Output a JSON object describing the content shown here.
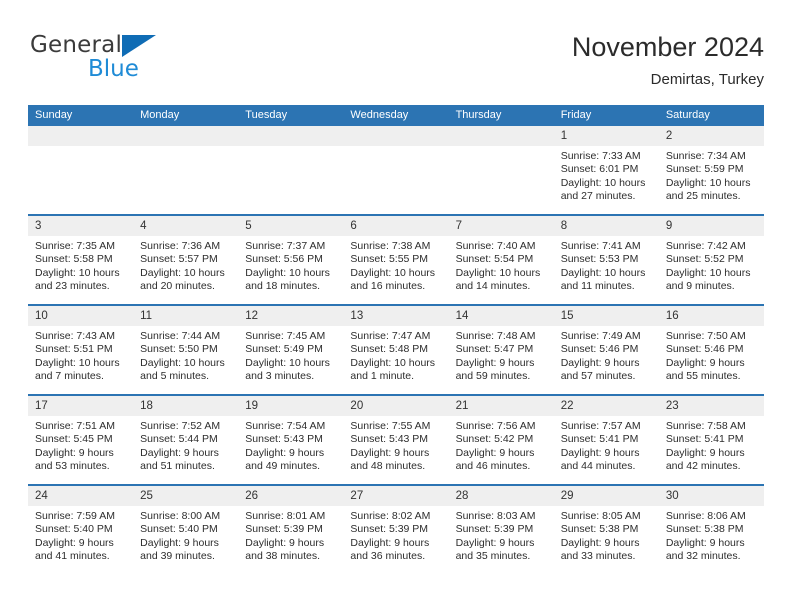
{
  "brand": {
    "name_part1": "General",
    "name_part2": "Blue",
    "logo_icon": "triangle-logo-icon",
    "accent_color": "#0f6cb5",
    "blue_text_color": "#1f8bd6"
  },
  "header": {
    "title": "November 2024",
    "subtitle": "Demirtas, Turkey"
  },
  "theme": {
    "header_blue": "#2c74b3",
    "daynum_band": "#efefef",
    "text": "#2d2d2d"
  },
  "weekdays": [
    "Sunday",
    "Monday",
    "Tuesday",
    "Wednesday",
    "Thursday",
    "Friday",
    "Saturday"
  ],
  "labels": {
    "sunrise": "Sunrise:",
    "sunset": "Sunset:",
    "daylight": "Daylight:"
  },
  "weeks": [
    [
      {
        "day": "",
        "sunrise": "",
        "sunset": "",
        "daylight": ""
      },
      {
        "day": "",
        "sunrise": "",
        "sunset": "",
        "daylight": ""
      },
      {
        "day": "",
        "sunrise": "",
        "sunset": "",
        "daylight": ""
      },
      {
        "day": "",
        "sunrise": "",
        "sunset": "",
        "daylight": ""
      },
      {
        "day": "",
        "sunrise": "",
        "sunset": "",
        "daylight": ""
      },
      {
        "day": "1",
        "sunrise": "Sunrise: 7:33 AM",
        "sunset": "Sunset: 6:01 PM",
        "daylight": "Daylight: 10 hours and 27 minutes."
      },
      {
        "day": "2",
        "sunrise": "Sunrise: 7:34 AM",
        "sunset": "Sunset: 5:59 PM",
        "daylight": "Daylight: 10 hours and 25 minutes."
      }
    ],
    [
      {
        "day": "3",
        "sunrise": "Sunrise: 7:35 AM",
        "sunset": "Sunset: 5:58 PM",
        "daylight": "Daylight: 10 hours and 23 minutes."
      },
      {
        "day": "4",
        "sunrise": "Sunrise: 7:36 AM",
        "sunset": "Sunset: 5:57 PM",
        "daylight": "Daylight: 10 hours and 20 minutes."
      },
      {
        "day": "5",
        "sunrise": "Sunrise: 7:37 AM",
        "sunset": "Sunset: 5:56 PM",
        "daylight": "Daylight: 10 hours and 18 minutes."
      },
      {
        "day": "6",
        "sunrise": "Sunrise: 7:38 AM",
        "sunset": "Sunset: 5:55 PM",
        "daylight": "Daylight: 10 hours and 16 minutes."
      },
      {
        "day": "7",
        "sunrise": "Sunrise: 7:40 AM",
        "sunset": "Sunset: 5:54 PM",
        "daylight": "Daylight: 10 hours and 14 minutes."
      },
      {
        "day": "8",
        "sunrise": "Sunrise: 7:41 AM",
        "sunset": "Sunset: 5:53 PM",
        "daylight": "Daylight: 10 hours and 11 minutes."
      },
      {
        "day": "9",
        "sunrise": "Sunrise: 7:42 AM",
        "sunset": "Sunset: 5:52 PM",
        "daylight": "Daylight: 10 hours and 9 minutes."
      }
    ],
    [
      {
        "day": "10",
        "sunrise": "Sunrise: 7:43 AM",
        "sunset": "Sunset: 5:51 PM",
        "daylight": "Daylight: 10 hours and 7 minutes."
      },
      {
        "day": "11",
        "sunrise": "Sunrise: 7:44 AM",
        "sunset": "Sunset: 5:50 PM",
        "daylight": "Daylight: 10 hours and 5 minutes."
      },
      {
        "day": "12",
        "sunrise": "Sunrise: 7:45 AM",
        "sunset": "Sunset: 5:49 PM",
        "daylight": "Daylight: 10 hours and 3 minutes."
      },
      {
        "day": "13",
        "sunrise": "Sunrise: 7:47 AM",
        "sunset": "Sunset: 5:48 PM",
        "daylight": "Daylight: 10 hours and 1 minute."
      },
      {
        "day": "14",
        "sunrise": "Sunrise: 7:48 AM",
        "sunset": "Sunset: 5:47 PM",
        "daylight": "Daylight: 9 hours and 59 minutes."
      },
      {
        "day": "15",
        "sunrise": "Sunrise: 7:49 AM",
        "sunset": "Sunset: 5:46 PM",
        "daylight": "Daylight: 9 hours and 57 minutes."
      },
      {
        "day": "16",
        "sunrise": "Sunrise: 7:50 AM",
        "sunset": "Sunset: 5:46 PM",
        "daylight": "Daylight: 9 hours and 55 minutes."
      }
    ],
    [
      {
        "day": "17",
        "sunrise": "Sunrise: 7:51 AM",
        "sunset": "Sunset: 5:45 PM",
        "daylight": "Daylight: 9 hours and 53 minutes."
      },
      {
        "day": "18",
        "sunrise": "Sunrise: 7:52 AM",
        "sunset": "Sunset: 5:44 PM",
        "daylight": "Daylight: 9 hours and 51 minutes."
      },
      {
        "day": "19",
        "sunrise": "Sunrise: 7:54 AM",
        "sunset": "Sunset: 5:43 PM",
        "daylight": "Daylight: 9 hours and 49 minutes."
      },
      {
        "day": "20",
        "sunrise": "Sunrise: 7:55 AM",
        "sunset": "Sunset: 5:43 PM",
        "daylight": "Daylight: 9 hours and 48 minutes."
      },
      {
        "day": "21",
        "sunrise": "Sunrise: 7:56 AM",
        "sunset": "Sunset: 5:42 PM",
        "daylight": "Daylight: 9 hours and 46 minutes."
      },
      {
        "day": "22",
        "sunrise": "Sunrise: 7:57 AM",
        "sunset": "Sunset: 5:41 PM",
        "daylight": "Daylight: 9 hours and 44 minutes."
      },
      {
        "day": "23",
        "sunrise": "Sunrise: 7:58 AM",
        "sunset": "Sunset: 5:41 PM",
        "daylight": "Daylight: 9 hours and 42 minutes."
      }
    ],
    [
      {
        "day": "24",
        "sunrise": "Sunrise: 7:59 AM",
        "sunset": "Sunset: 5:40 PM",
        "daylight": "Daylight: 9 hours and 41 minutes."
      },
      {
        "day": "25",
        "sunrise": "Sunrise: 8:00 AM",
        "sunset": "Sunset: 5:40 PM",
        "daylight": "Daylight: 9 hours and 39 minutes."
      },
      {
        "day": "26",
        "sunrise": "Sunrise: 8:01 AM",
        "sunset": "Sunset: 5:39 PM",
        "daylight": "Daylight: 9 hours and 38 minutes."
      },
      {
        "day": "27",
        "sunrise": "Sunrise: 8:02 AM",
        "sunset": "Sunset: 5:39 PM",
        "daylight": "Daylight: 9 hours and 36 minutes."
      },
      {
        "day": "28",
        "sunrise": "Sunrise: 8:03 AM",
        "sunset": "Sunset: 5:39 PM",
        "daylight": "Daylight: 9 hours and 35 minutes."
      },
      {
        "day": "29",
        "sunrise": "Sunrise: 8:05 AM",
        "sunset": "Sunset: 5:38 PM",
        "daylight": "Daylight: 9 hours and 33 minutes."
      },
      {
        "day": "30",
        "sunrise": "Sunrise: 8:06 AM",
        "sunset": "Sunset: 5:38 PM",
        "daylight": "Daylight: 9 hours and 32 minutes."
      }
    ]
  ]
}
